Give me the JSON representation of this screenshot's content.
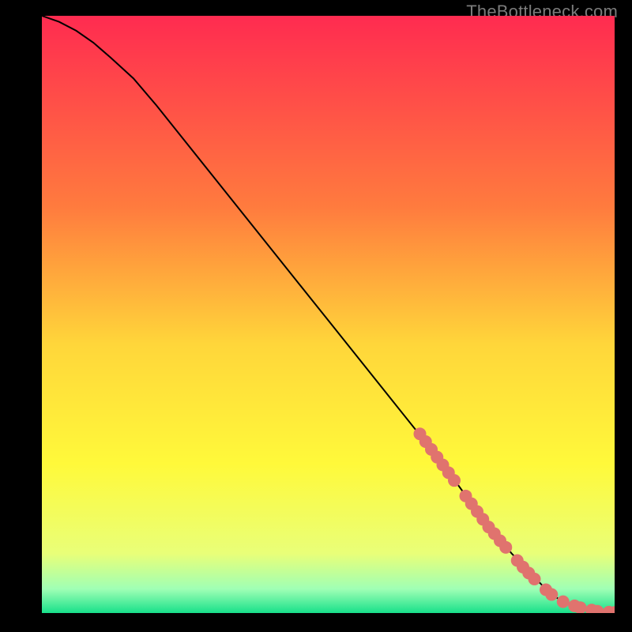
{
  "watermark": "TheBottleneck.com",
  "colors": {
    "marker": "#e0736e",
    "line": "#000000",
    "gradient_top": "#ff2b50",
    "gradient_mid1": "#ff7b3e",
    "gradient_mid2": "#ffd63a",
    "gradient_mid3": "#fff93a",
    "gradient_mid4": "#e9ff78",
    "gradient_mid5": "#9fffb5",
    "gradient_bottom": "#18e08a"
  },
  "chart_data": {
    "type": "line",
    "title": "",
    "xlabel": "",
    "ylabel": "",
    "xlim": [
      0,
      100
    ],
    "ylim": [
      0,
      100
    ],
    "series": [
      {
        "name": "curve",
        "x": [
          0,
          3,
          6,
          9,
          12,
          16,
          20,
          25,
          30,
          35,
          40,
          45,
          50,
          55,
          60,
          65,
          70,
          73,
          76,
          79,
          82,
          85,
          88,
          90,
          92,
          94,
          96,
          98,
          100
        ],
        "y": [
          100,
          99,
          97.5,
          95.5,
          93,
          89.5,
          85,
          79,
          73,
          67,
          61,
          55,
          49,
          43,
          37,
          31,
          25,
          21,
          17,
          13.5,
          10,
          7,
          4,
          2.5,
          1.5,
          0.8,
          0.4,
          0.15,
          0.1
        ]
      }
    ],
    "markers": {
      "name": "highlighted-points",
      "x": [
        66,
        67,
        68,
        69,
        70,
        71,
        72,
        74,
        75,
        76,
        77,
        78,
        79,
        80,
        81,
        83,
        84,
        85,
        86,
        88,
        89,
        91,
        93,
        94,
        96,
        97,
        99,
        100
      ],
      "y": [
        30,
        28.7,
        27.4,
        26.1,
        24.8,
        23.5,
        22.2,
        19.6,
        18.3,
        17.0,
        15.7,
        14.4,
        13.3,
        12.1,
        11.0,
        8.8,
        7.7,
        6.7,
        5.7,
        3.9,
        3.1,
        1.9,
        1.2,
        0.9,
        0.5,
        0.3,
        0.15,
        0.1
      ]
    }
  }
}
